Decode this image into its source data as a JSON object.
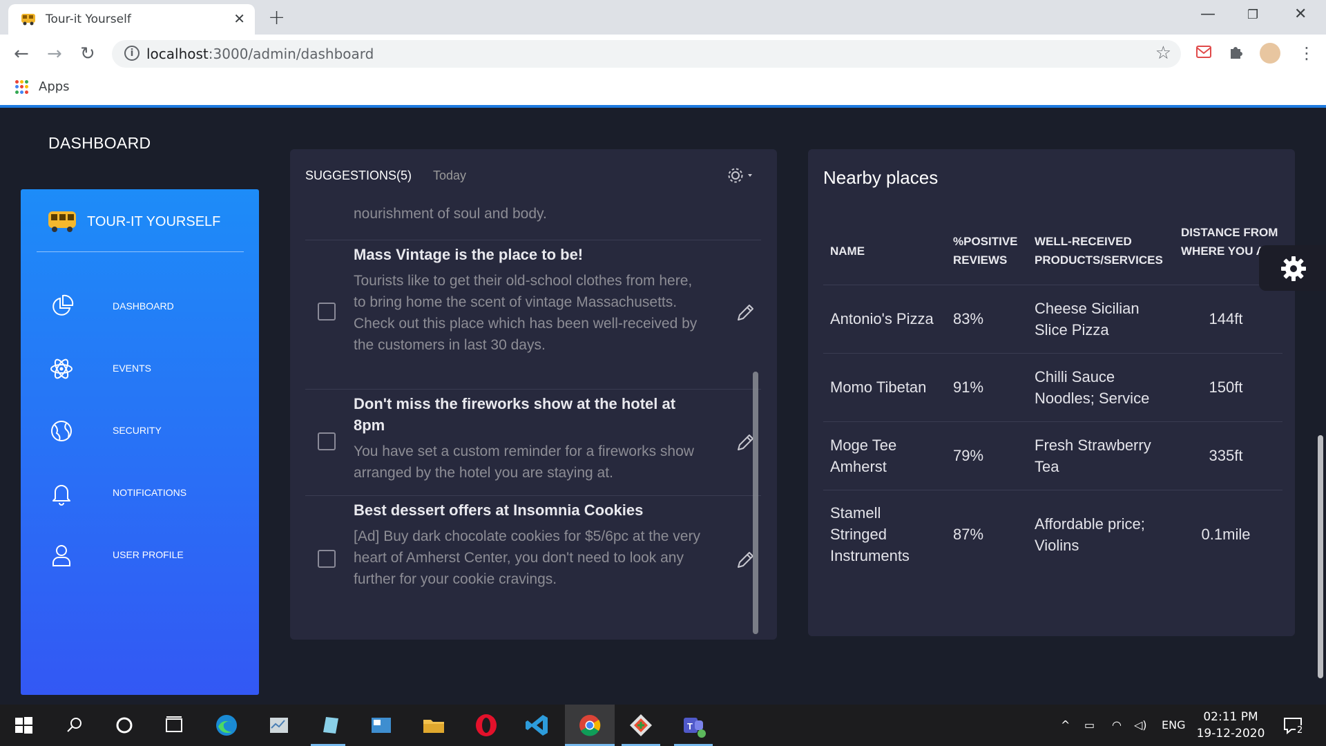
{
  "browser": {
    "tab_title": "Tour-it Yourself",
    "url_host": "localhost",
    "url_path": ":3000/admin/dashboard",
    "bookmarks_apps": "Apps"
  },
  "app": {
    "page_title": "DASHBOARD",
    "brand": "TOUR-IT YOURSELF",
    "nav": [
      {
        "label": "DASHBOARD",
        "icon": "pie-chart-icon"
      },
      {
        "label": "EVENTS",
        "icon": "atom-icon"
      },
      {
        "label": "SECURITY",
        "icon": "globe-icon"
      },
      {
        "label": "NOTIFICATIONS",
        "icon": "bell-icon"
      },
      {
        "label": "USER PROFILE",
        "icon": "user-icon"
      }
    ]
  },
  "suggestions": {
    "heading": "SUGGESTIONS(5)",
    "filter": "Today",
    "partial_text": "nourishment of soul and body.",
    "items": [
      {
        "title": "Mass Vintage is the place to be!",
        "description": "Tourists like to get their old-school clothes from here, to bring home the scent of vintage Massachusetts. Check out this place which has been well-received by the customers in last 30 days."
      },
      {
        "title": "Don't miss the fireworks show at the hotel at 8pm",
        "description": "You have set a custom reminder for a fireworks show arranged by the hotel you are staying at."
      },
      {
        "title": "Best dessert offers at Insomnia Cookies",
        "description": "[Ad] Buy dark chocolate cookies for $5/6pc at the very heart of Amherst Center, you don't need to look any further for your cookie cravings."
      }
    ]
  },
  "nearby": {
    "title": "Nearby places",
    "columns": [
      "NAME",
      "%POSITIVE REVIEWS",
      "WELL-RECEIVED PRODUCTS/SERVICES",
      "DISTANCE FROM WHERE YOU ARE"
    ],
    "rows": [
      {
        "name": "Antonio's Pizza",
        "positive": "83%",
        "products": "Cheese Sicilian Slice Pizza",
        "distance": "144ft"
      },
      {
        "name": "Momo Tibetan",
        "positive": "91%",
        "products": "Chilli Sauce Noodles; Service",
        "distance": "150ft"
      },
      {
        "name": "Moge Tee Amherst",
        "positive": "79%",
        "products": "Fresh Strawberry Tea",
        "distance": "335ft"
      },
      {
        "name": "Stamell Stringed Instruments",
        "positive": "87%",
        "products": "Affordable price; Violins",
        "distance": "0.1mile"
      }
    ]
  },
  "taskbar": {
    "language": "ENG",
    "time": "02:11 PM",
    "date": "19-12-2020",
    "notifications_count": "2"
  },
  "colors": {
    "sidebar_top": "#1d8cf8",
    "sidebar_bottom": "#3358f4",
    "card_bg": "#27293d",
    "page_bg": "#1a1e2a"
  }
}
